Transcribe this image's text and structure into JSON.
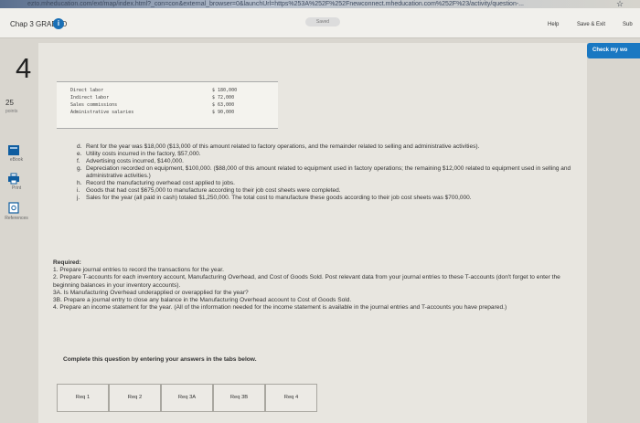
{
  "browser": {
    "url_text": "ezto.mheducation.com/ext/map/index.html?_con=con&external_browser=0&launchUrl=https%253A%252F%252Fnewconnect.mheducation.com%252F%23/activity/question-...",
    "star": "☆"
  },
  "header": {
    "title": "Chap 3 GRADED",
    "info_icon": "i",
    "saved": "Saved",
    "help": "Help",
    "save_exit": "Save & Exit",
    "submit": "Sub"
  },
  "check_work": "Check my wo",
  "question": {
    "number": "4",
    "points_value": "25",
    "points_label": "points"
  },
  "sidebar": [
    {
      "label": "eBook",
      "icon": "book-icon"
    },
    {
      "label": "Print",
      "icon": "print-icon"
    },
    {
      "label": "References",
      "icon": "references-icon"
    }
  ],
  "table": [
    {
      "label": "Direct labor",
      "amount": "$ 180,000"
    },
    {
      "label": "Indirect labor",
      "amount": "$ 72,000"
    },
    {
      "label": "Sales commissions",
      "amount": "$ 63,000"
    },
    {
      "label": "Administrative salaries",
      "amount": "$ 90,000"
    }
  ],
  "transactions": [
    {
      "marker": "d.",
      "text": "Rent for the year was $18,000 ($13,000 of this amount related to factory operations, and the remainder related to selling and administrative activities)."
    },
    {
      "marker": "e.",
      "text": "Utility costs incurred in the factory, $57,000."
    },
    {
      "marker": "f.",
      "text": "Advertising costs incurred, $140,000."
    },
    {
      "marker": "g.",
      "text": "Depreciation recorded on equipment, $100,000. ($88,000 of this amount related to equipment used in factory operations; the remaining $12,000 related to equipment used in selling and administrative activities.)"
    },
    {
      "marker": "h.",
      "text": "Record the manufacturing overhead cost applied to jobs."
    },
    {
      "marker": "i.",
      "text": "Goods that had cost $675,000 to manufacture according to their job cost sheets were completed."
    },
    {
      "marker": "j.",
      "text": "Sales for the year (all paid in cash) totaled $1,250,000. The total cost to manufacture these goods according to their job cost sheets was $700,000."
    }
  ],
  "required": {
    "heading": "Required:",
    "items": [
      "1. Prepare journal entries to record the transactions for the year.",
      "2. Prepare T-accounts for each inventory account, Manufacturing Overhead, and Cost of Goods Sold. Post relevant data from your journal entries to these T-accounts (don't forget to enter the beginning balances in your inventory accounts).",
      "3A. Is Manufacturing Overhead underapplied or overapplied for the year?",
      "3B. Prepare a journal entry to close any balance in the Manufacturing Overhead account to Cost of Goods Sold.",
      "4. Prepare an income statement for the year. (All of the information needed for the income statement is available in the journal entries and T-accounts you have prepared.)"
    ]
  },
  "instruction": "Complete this question by entering your answers in the tabs below.",
  "tabs": [
    "Req 1",
    "Req 2",
    "Req 3A",
    "Req 3B",
    "Req 4"
  ]
}
